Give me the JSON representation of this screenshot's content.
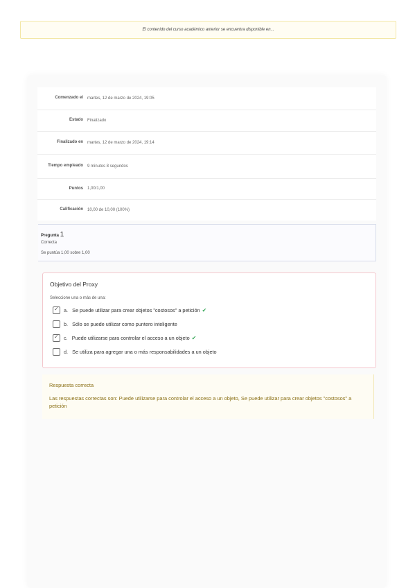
{
  "notice": "El contenido del curso académico anterior se encuentra disponible en...",
  "summary": {
    "rows": [
      {
        "label": "Comenzado el",
        "value": "martes, 12 de marzo de 2024, 19:05"
      },
      {
        "label": "Estado",
        "value": "Finalizado"
      },
      {
        "label": "Finalizado en",
        "value": "martes, 12 de marzo de 2024, 19:14"
      },
      {
        "label": "Tiempo empleado",
        "value": "9 minutos 8 segundos"
      },
      {
        "label": "Puntos",
        "value": "1,00/1,00"
      },
      {
        "label": "Calificación",
        "value": "10,00 de 10,00 (100%)"
      }
    ]
  },
  "question_info": {
    "label": "Pregunta",
    "number": "1",
    "status": "Correcta",
    "points": "Se puntúa 1,00 sobre 1,00"
  },
  "question": {
    "title": "Objetivo del Proxy",
    "prompt": "Seleccione una o más de una:",
    "options": [
      {
        "letter": "a.",
        "text": "Se puede utilizar para crear objetos \"costosos\" a petición",
        "checked": true,
        "correct": true
      },
      {
        "letter": "b.",
        "text": "Sólo se puede utilizar como puntero inteligente",
        "checked": false,
        "correct": false
      },
      {
        "letter": "c.",
        "text": "Puede utilizarse para controlar el acceso a un objeto",
        "checked": true,
        "correct": true
      },
      {
        "letter": "d.",
        "text": "Se utiliza para agregar una o más responsabilidades a un objeto",
        "checked": false,
        "correct": false
      }
    ],
    "tick_symbol": "✔"
  },
  "feedback": {
    "result": "Respuesta correcta",
    "answer": "Las respuestas correctas son: Puede utilizarse para controlar el acceso a un objeto, Se puede utilizar para crear objetos \"costosos\" a petición"
  },
  "colors": {
    "correct": "#3aa85b",
    "feedback_text": "#8a6f15",
    "question_border": "#f3c6cc"
  }
}
